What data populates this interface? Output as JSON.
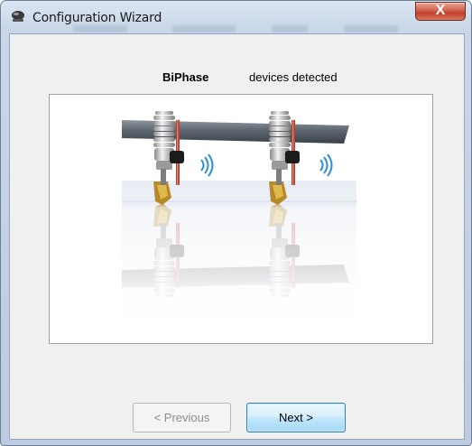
{
  "window": {
    "title": "Configuration Wizard",
    "close_label": "X",
    "icon": "wizard-app-icon"
  },
  "main": {
    "brand": "BiPhase",
    "status": "devices detected",
    "image": "two-fault-indicators-on-power-line-illustration"
  },
  "buttons": {
    "previous": "< Previous",
    "next": "Next >"
  },
  "colors": {
    "client_bg": "#f0f0f0",
    "close_red": "#c2412a",
    "next_border": "#3c7fb1",
    "wave_blue": "#2f8fd6"
  }
}
